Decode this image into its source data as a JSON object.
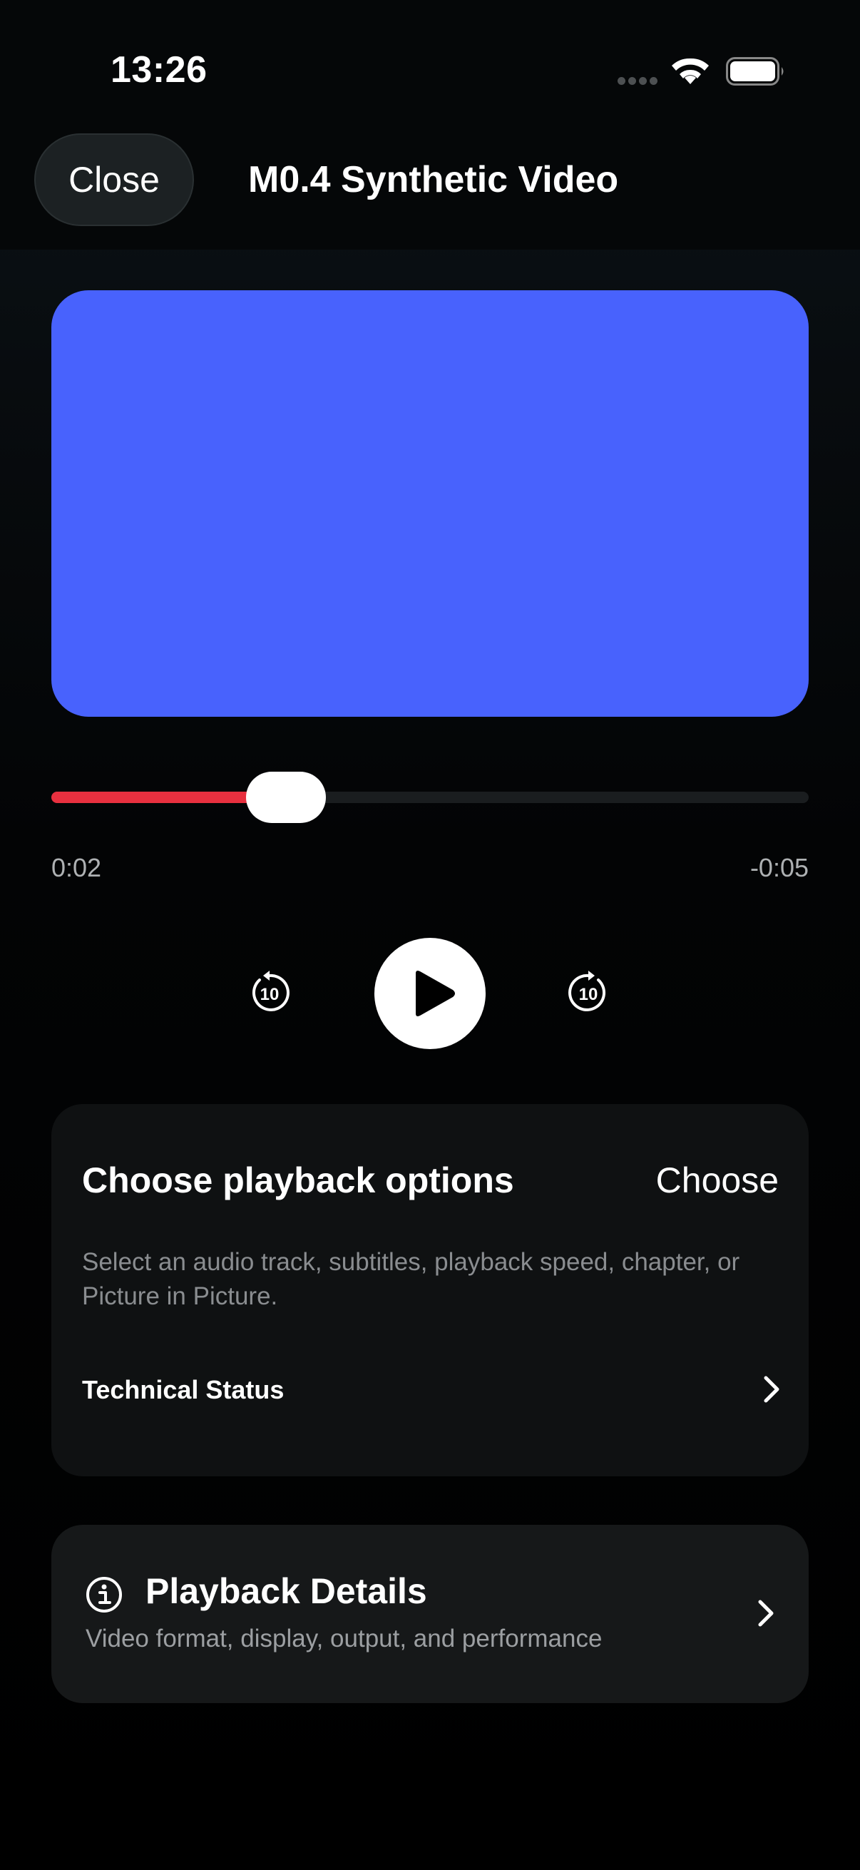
{
  "status_bar": {
    "time": "13:26"
  },
  "nav": {
    "close_label": "Close",
    "title": "M0.4 Synthetic Video"
  },
  "video": {
    "background_color": "#4862fd"
  },
  "player": {
    "progress": 0.31,
    "elapsed": "0:02",
    "remaining": "-0:05",
    "skip_back_label": "10",
    "skip_forward_label": "10",
    "progress_color": "#e8303f"
  },
  "options": {
    "title": "Choose playback options",
    "choose_label": "Choose",
    "description": "Select an audio track, subtitles, playback speed, chapter, or Picture in Picture.",
    "technical_status_label": "Technical Status"
  },
  "details": {
    "title": "Playback Details",
    "subtitle": "Video format, display, output, and performance"
  }
}
